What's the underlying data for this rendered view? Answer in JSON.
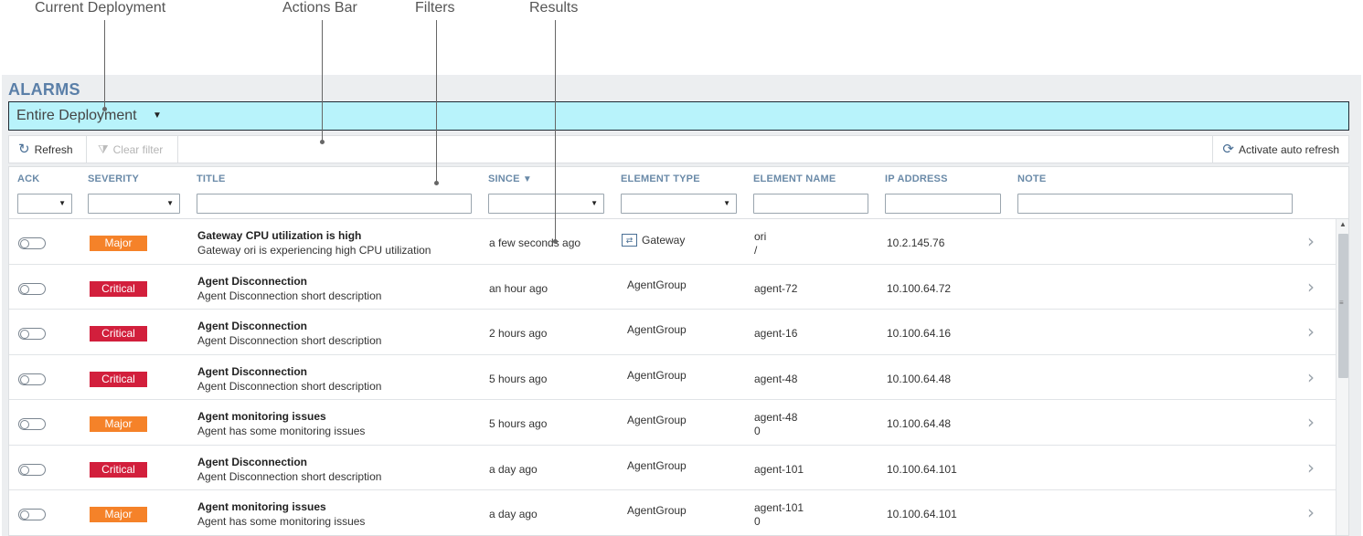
{
  "callouts": {
    "current_deployment": "Current Deployment",
    "actions_bar": "Actions Bar",
    "filters": "Filters",
    "results": "Results"
  },
  "page": {
    "title": "ALARMS",
    "deployment": "Entire Deployment"
  },
  "actions": {
    "refresh": "Refresh",
    "clear_filter": "Clear filter",
    "auto_refresh": "Activate auto refresh"
  },
  "columns": {
    "ack": "ACK",
    "severity": "SEVERITY",
    "title": "TITLE",
    "since": "SINCE",
    "element_type": "ELEMENT TYPE",
    "element_name": "ELEMENT NAME",
    "ip_address": "IP ADDRESS",
    "note": "NOTE"
  },
  "colors": {
    "major": "#f58229",
    "critical": "#d21f3c",
    "deployment_bar": "#b8f3fb",
    "header_text": "#6a8aa8"
  },
  "rows": [
    {
      "severity": "Major",
      "title": "Gateway CPU utilization is high",
      "description": "Gateway ori is experiencing high CPU utilization",
      "since": "a few seconds ago",
      "element_type": "Gateway",
      "element_name": "ori",
      "element_name_sub": "/",
      "ip": "10.2.145.76"
    },
    {
      "severity": "Critical",
      "title": "Agent Disconnection",
      "description": "Agent Disconnection short description",
      "since": "an hour ago",
      "element_type": "AgentGroup",
      "element_name": "agent-72",
      "element_name_sub": "",
      "ip": "10.100.64.72"
    },
    {
      "severity": "Critical",
      "title": "Agent Disconnection",
      "description": "Agent Disconnection short description",
      "since": "2 hours ago",
      "element_type": "AgentGroup",
      "element_name": "agent-16",
      "element_name_sub": "",
      "ip": "10.100.64.16"
    },
    {
      "severity": "Critical",
      "title": "Agent Disconnection",
      "description": "Agent Disconnection short description",
      "since": "5 hours ago",
      "element_type": "AgentGroup",
      "element_name": "agent-48",
      "element_name_sub": "",
      "ip": "10.100.64.48"
    },
    {
      "severity": "Major",
      "title": "Agent monitoring issues",
      "description": "Agent has some monitoring issues",
      "since": "5 hours ago",
      "element_type": "AgentGroup",
      "element_name": "agent-48",
      "element_name_sub": "0",
      "ip": "10.100.64.48"
    },
    {
      "severity": "Critical",
      "title": "Agent Disconnection",
      "description": "Agent Disconnection short description",
      "since": "a day ago",
      "element_type": "AgentGroup",
      "element_name": "agent-101",
      "element_name_sub": "",
      "ip": "10.100.64.101"
    },
    {
      "severity": "Major",
      "title": "Agent monitoring issues",
      "description": "Agent has some monitoring issues",
      "since": "a day ago",
      "element_type": "AgentGroup",
      "element_name": "agent-101",
      "element_name_sub": "0",
      "ip": "10.100.64.101"
    }
  ]
}
